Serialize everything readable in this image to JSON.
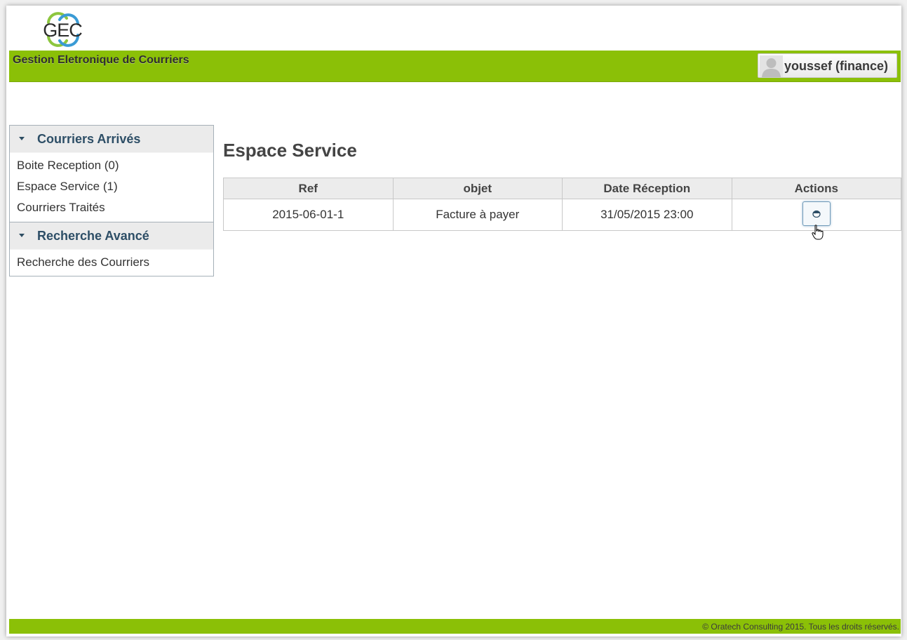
{
  "header": {
    "logo_text": "GEC",
    "app_title": "Gestion Eletronique de Courriers",
    "user_name": "youssef (finance)",
    "avatar_icon": "user-silhouette-icon",
    "bar_color": "#8bc007"
  },
  "sidebar": {
    "panels": [
      {
        "title": "Courriers Arrivés",
        "items": [
          "Boite Reception (0)",
          "Espace Service (1)",
          "Courriers Traités"
        ]
      },
      {
        "title": "Recherche Avancé",
        "items": [
          "Recherche des Courriers"
        ]
      }
    ]
  },
  "main": {
    "title": "Espace Service",
    "table": {
      "columns": [
        "Ref",
        "objet",
        "Date Réception",
        "Actions"
      ],
      "rows": [
        {
          "ref": "2015-06-01-1",
          "objet": "Facture à payer",
          "date": "31/05/2015 23:00",
          "action_icon": "view-icon"
        }
      ]
    }
  },
  "footer": {
    "text": "© Oratech Consulting 2015. Tous les droits réservés."
  }
}
